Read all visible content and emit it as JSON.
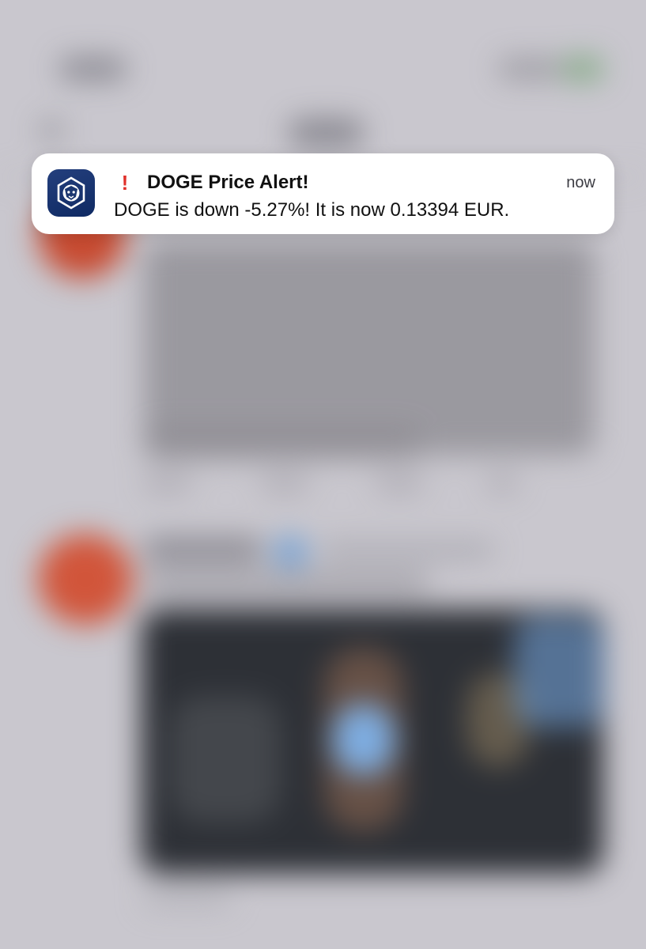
{
  "notification": {
    "app_icon": "crypto-com-lion-icon",
    "alert_icon": "exclamation-icon",
    "alert_symbol": "!",
    "title": "DOGE Price Alert!",
    "time": "now",
    "body": "DOGE is down -5.27%! It is now 0.13394 EUR.",
    "colors": {
      "app_icon_bg": "#1c3770",
      "alert": "#e0302a",
      "banner_bg": "#ffffff"
    }
  }
}
